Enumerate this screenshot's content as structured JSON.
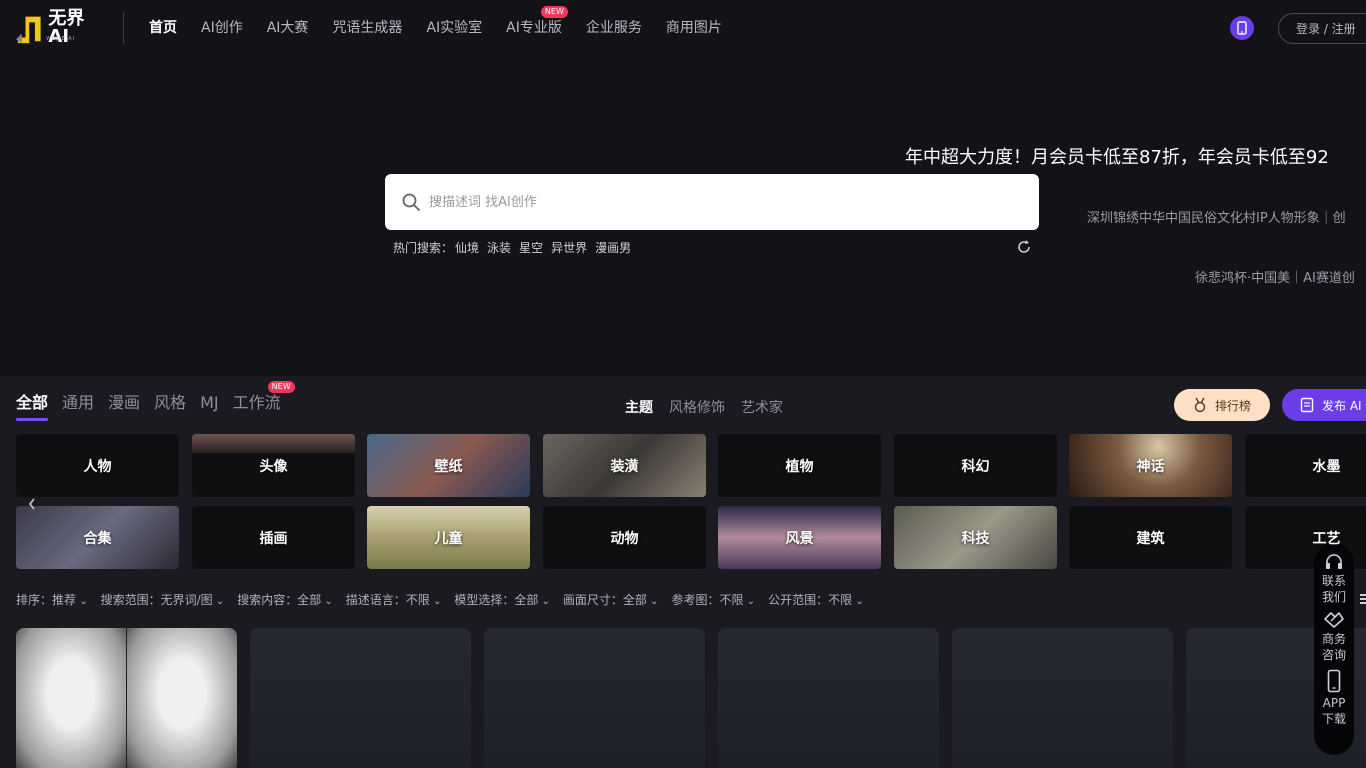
{
  "header": {
    "logo_text": "无界AI",
    "logo_sub": "WUJIE AI",
    "nav": [
      {
        "label": "首页",
        "active": true
      },
      {
        "label": "AI创作"
      },
      {
        "label": "AI大赛"
      },
      {
        "label": "咒语生成器"
      },
      {
        "label": "AI实验室"
      },
      {
        "label": "AI专业版",
        "badge": "NEW"
      },
      {
        "label": "企业服务"
      },
      {
        "label": "商用图片"
      }
    ],
    "login_label": "登录 / 注册"
  },
  "hero": {
    "promo": "年中超大力度！月会员卡低至87折，年会员卡低至92",
    "marquee_1": "深圳锦绣中华中国民俗文化村IP人物形象｜创",
    "marquee_2": "徐悲鸿杯·中国美｜AI赛道创",
    "search_placeholder": "搜描述词 找AI创作",
    "hot_label": "热门搜索：",
    "hot_terms": [
      "仙境",
      "泳装",
      "星空",
      "异世界",
      "漫画男"
    ]
  },
  "content": {
    "tabs": [
      {
        "label": "全部",
        "active": true
      },
      {
        "label": "通用"
      },
      {
        "label": "漫画"
      },
      {
        "label": "风格"
      },
      {
        "label": "MJ"
      },
      {
        "label": "工作流",
        "badge": "NEW"
      }
    ],
    "subtabs": [
      {
        "label": "主题",
        "active": true
      },
      {
        "label": "风格修饰"
      },
      {
        "label": "艺术家"
      }
    ],
    "rank_label": "排行榜",
    "publish_label": "发布 AI",
    "categories_row1": [
      "人物",
      "头像",
      "壁纸",
      "装潢",
      "植物",
      "科幻",
      "神话",
      "水墨"
    ],
    "categories_row2": [
      "合集",
      "插画",
      "儿童",
      "动物",
      "风景",
      "科技",
      "建筑",
      "工艺"
    ],
    "filters": [
      "排序：推荐",
      "搜索范围：无界词/图",
      "搜索内容：全部",
      "描述语言：不限",
      "模型选择：全部",
      "画面尺寸：全部",
      "参考图：不限",
      "公开范围：不限"
    ]
  },
  "side_panel": {
    "contact": [
      "联系",
      "我们"
    ],
    "business": [
      "商务",
      "咨询"
    ],
    "app": [
      "APP",
      "下载"
    ]
  },
  "colors": {
    "accent": "#6a3de8",
    "new_badge": "#f0385a",
    "rank_bg": "#fde1c7"
  }
}
